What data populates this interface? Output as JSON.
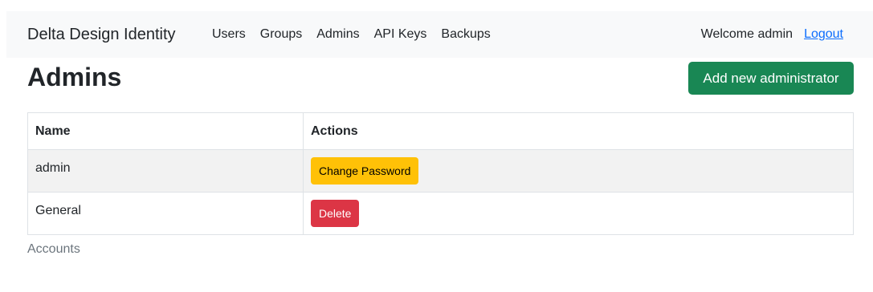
{
  "navbar": {
    "brand": "Delta Design Identity",
    "links": [
      "Users",
      "Groups",
      "Admins",
      "API Keys",
      "Backups"
    ],
    "welcome": "Welcome admin",
    "logout": "Logout"
  },
  "page": {
    "title": "Admins",
    "add_button": "Add new administrator"
  },
  "table": {
    "headers": [
      "Name",
      "Actions"
    ],
    "rows": [
      {
        "name": "admin",
        "action": "Change Password"
      },
      {
        "name": "General",
        "action": "Delete"
      }
    ]
  },
  "footer": {
    "text": "Accounts"
  },
  "colors": {
    "navbar_bg": "#f8f9fa",
    "success": "#198754",
    "warning": "#ffc107",
    "danger": "#dc3545",
    "link": "#0d6efd"
  }
}
